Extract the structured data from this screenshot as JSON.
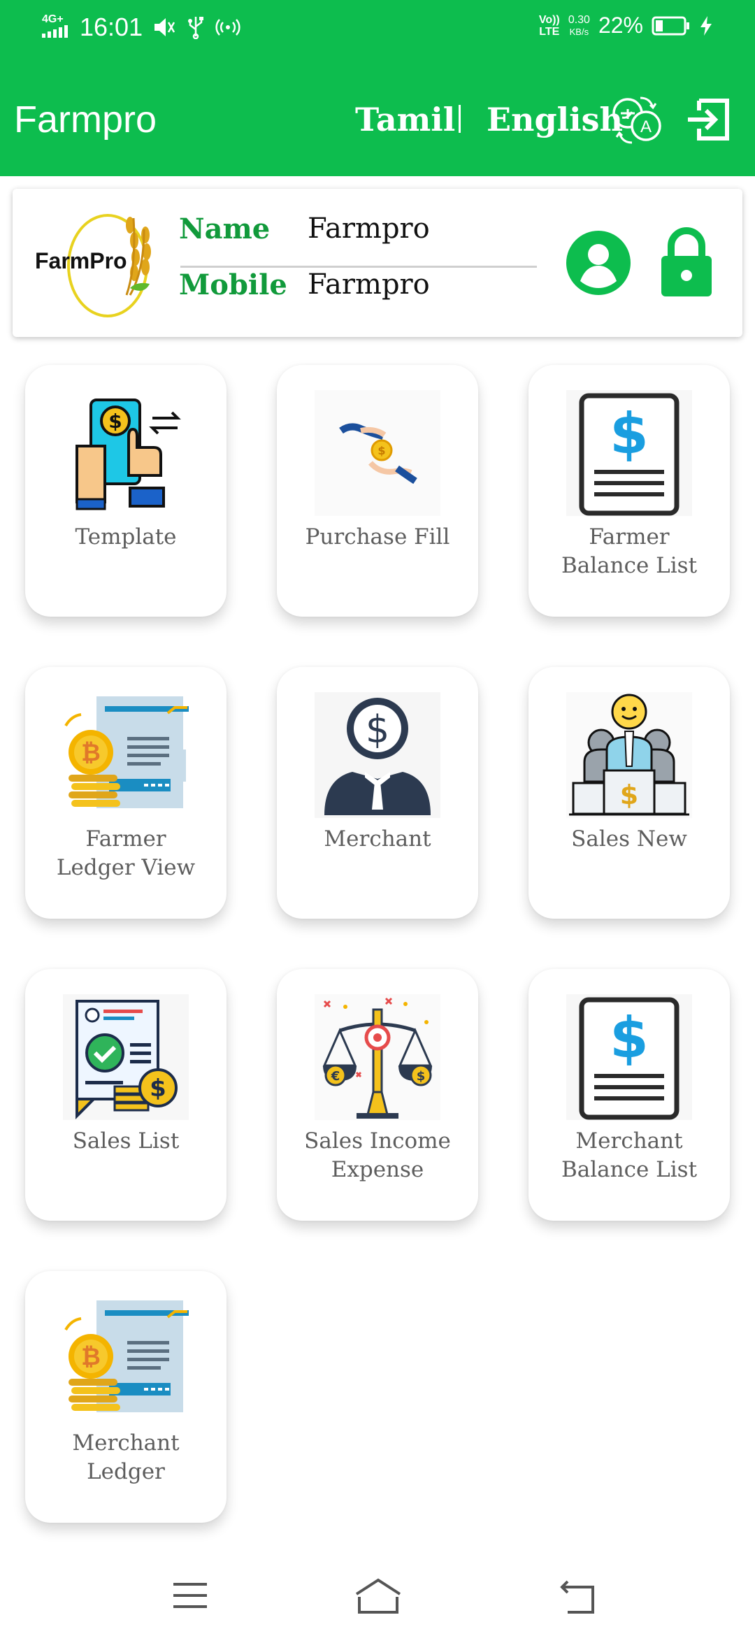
{
  "status_bar": {
    "network": "4G+",
    "time": "16:01",
    "volte": "Vo)) LTE",
    "speed_value": "0.30",
    "speed_unit": "KB/s",
    "battery": "22%"
  },
  "app_bar": {
    "title": "Farmpro",
    "lang_tamil": "Tamil",
    "lang_english": "English"
  },
  "profile": {
    "logo_text": "FarmPro",
    "name_label": "Name",
    "name_value": "Farmpro",
    "mobile_label": "Mobile",
    "mobile_value": "Farmpro"
  },
  "tiles": [
    {
      "line1": "Template",
      "line2": "",
      "icon": "mobile-payment-icon"
    },
    {
      "line1": "Purchase Fill",
      "line2": "",
      "icon": "coin-handover-icon"
    },
    {
      "line1": "Farmer",
      "line2": "Balance List",
      "icon": "dollar-document-icon"
    },
    {
      "line1": "Farmer",
      "line2": "Ledger View",
      "icon": "bitcoin-ledger-icon"
    },
    {
      "line1": "Merchant",
      "line2": "",
      "icon": "merchant-icon"
    },
    {
      "line1": "Sales New",
      "line2": "",
      "icon": "sales-podium-icon"
    },
    {
      "line1": "Sales List",
      "line2": "",
      "icon": "checked-invoice-icon"
    },
    {
      "line1": "Sales Income",
      "line2": "Expense",
      "icon": "balance-scale-icon"
    },
    {
      "line1": "Merchant",
      "line2": "Balance List",
      "icon": "dollar-document-icon"
    },
    {
      "line1": "Merchant",
      "line2": "Ledger",
      "icon": "bitcoin-ledger-icon"
    }
  ],
  "colors": {
    "brand_green": "#0dbd4e",
    "label_green": "#119a3b"
  },
  "nav": {
    "menu_icon": "menu-icon",
    "home_icon": "home-icon",
    "back_icon": "back-icon"
  }
}
